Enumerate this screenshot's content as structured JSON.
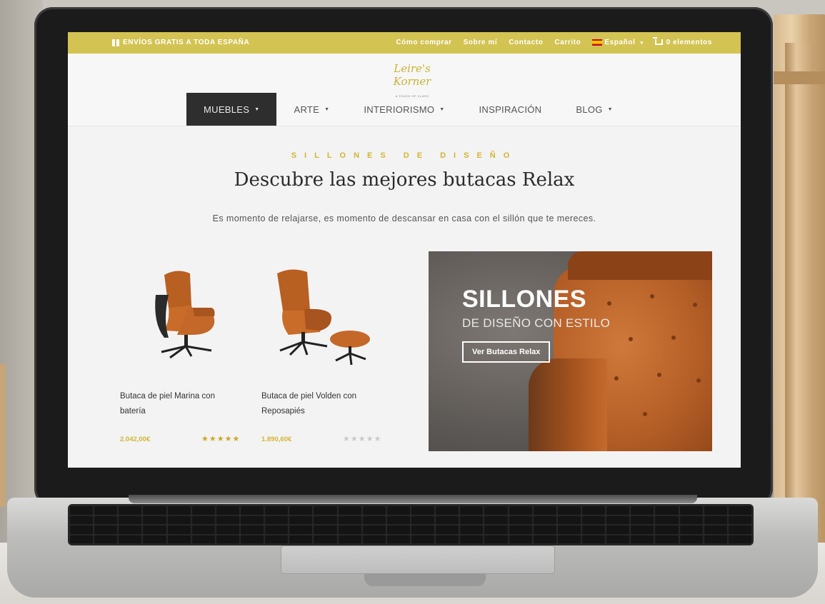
{
  "topbar": {
    "promo": "ENVÍOS GRATIS A TODA ESPAÑA",
    "links": [
      "Cómo comprar",
      "Sobre mí",
      "Contacto",
      "Carrito"
    ],
    "language": "Español",
    "cart": "0 elementos",
    "color": "#d3c352"
  },
  "logo": {
    "script": "Leire's Korner",
    "tagline": "A TOUCH OF CLASS"
  },
  "nav": {
    "items": [
      "MUEBLES",
      "ARTE",
      "INTERIORISMO",
      "INSPIRACIÓN",
      "BLOG"
    ],
    "active": "MUEBLES"
  },
  "hero": {
    "kicker": "SILLONES DE DISEÑO",
    "headline": "Descubre las mejores butacas Relax",
    "subtext": "Es momento de relajarse, es momento de descansar en casa con el sillón que te mereces."
  },
  "products": [
    {
      "name": "Butaca de piel Marina con batería",
      "price": "2.042,00€",
      "stars": "★★★★★",
      "rating": 5
    },
    {
      "name": "Butaca de piel Volden con Reposapiés",
      "price": "1.890,60€",
      "stars": "★★★★★",
      "rating": 0
    }
  ],
  "banner": {
    "title": "SILLONES",
    "subtitle": "DE DISEÑO CON ESTILO",
    "button": "Ver Butacas Relax"
  }
}
